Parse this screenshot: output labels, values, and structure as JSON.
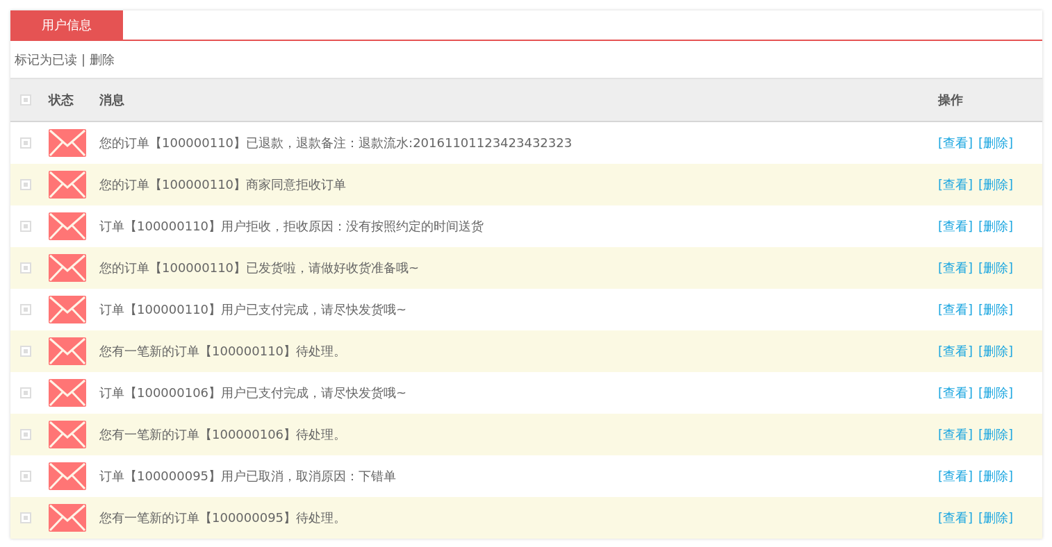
{
  "tabs": [
    {
      "label": "用户信息",
      "selected": true
    }
  ],
  "toolbar": {
    "mark_read": "标记为已读",
    "separator": "|",
    "delete": "删除"
  },
  "table": {
    "select_all": {
      "checked": false
    },
    "columns": [
      "状态",
      "消息",
      "操作"
    ],
    "rows": [
      {
        "checked": false,
        "message": "您的订单【100000110】已退款，退款备注：退款流水:20161101123423432323",
        "view": "[查看]",
        "delete": "[删除]"
      },
      {
        "checked": false,
        "message": "您的订单【100000110】商家同意拒收订单",
        "view": "[查看]",
        "delete": "[删除]"
      },
      {
        "checked": false,
        "message": "订单【100000110】用户拒收，拒收原因：没有按照约定的时间送货",
        "view": "[查看]",
        "delete": "[删除]"
      },
      {
        "checked": false,
        "message": "您的订单【100000110】已发货啦，请做好收货准备哦~",
        "view": "[查看]",
        "delete": "[删除]"
      },
      {
        "checked": false,
        "message": "订单【100000110】用户已支付完成，请尽快发货哦~",
        "view": "[查看]",
        "delete": "[删除]"
      },
      {
        "checked": false,
        "message": "您有一笔新的订单【100000110】待处理。",
        "view": "[查看]",
        "delete": "[删除]"
      },
      {
        "checked": false,
        "message": "订单【100000106】用户已支付完成，请尽快发货哦~",
        "view": "[查看]",
        "delete": "[删除]"
      },
      {
        "checked": false,
        "message": "您有一笔新的订单【100000106】待处理。",
        "view": "[查看]",
        "delete": "[删除]"
      },
      {
        "checked": false,
        "message": "订单【100000095】用户已取消，取消原因：下错单",
        "view": "[查看]",
        "delete": "[删除]"
      },
      {
        "checked": false,
        "message": "您有一笔新的订单【100000095】待处理。",
        "view": "[查看]",
        "delete": "[删除]"
      }
    ]
  }
}
